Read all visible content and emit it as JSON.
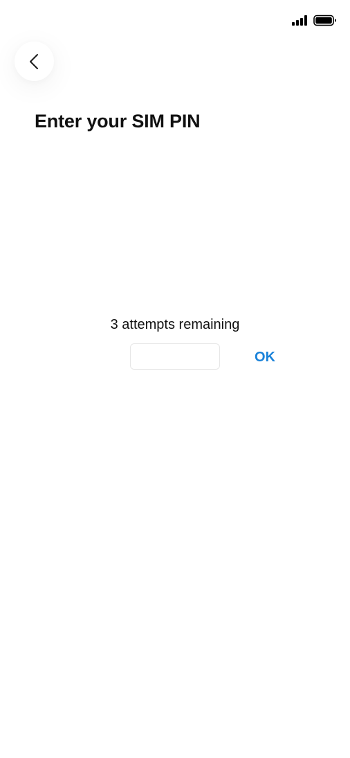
{
  "status_bar": {
    "signal_icon": "signal-bars-icon",
    "battery_icon": "battery-full-icon"
  },
  "header": {
    "back_icon": "chevron-left-icon"
  },
  "main": {
    "title": "Enter your SIM PIN",
    "attempts_text": "3 attempts remaining",
    "pin_value": "",
    "pin_placeholder": "",
    "ok_label": "OK"
  },
  "colors": {
    "accent": "#1a82d9",
    "text": "#111111",
    "background": "#ffffff",
    "input_border": "#e6e6e6"
  }
}
